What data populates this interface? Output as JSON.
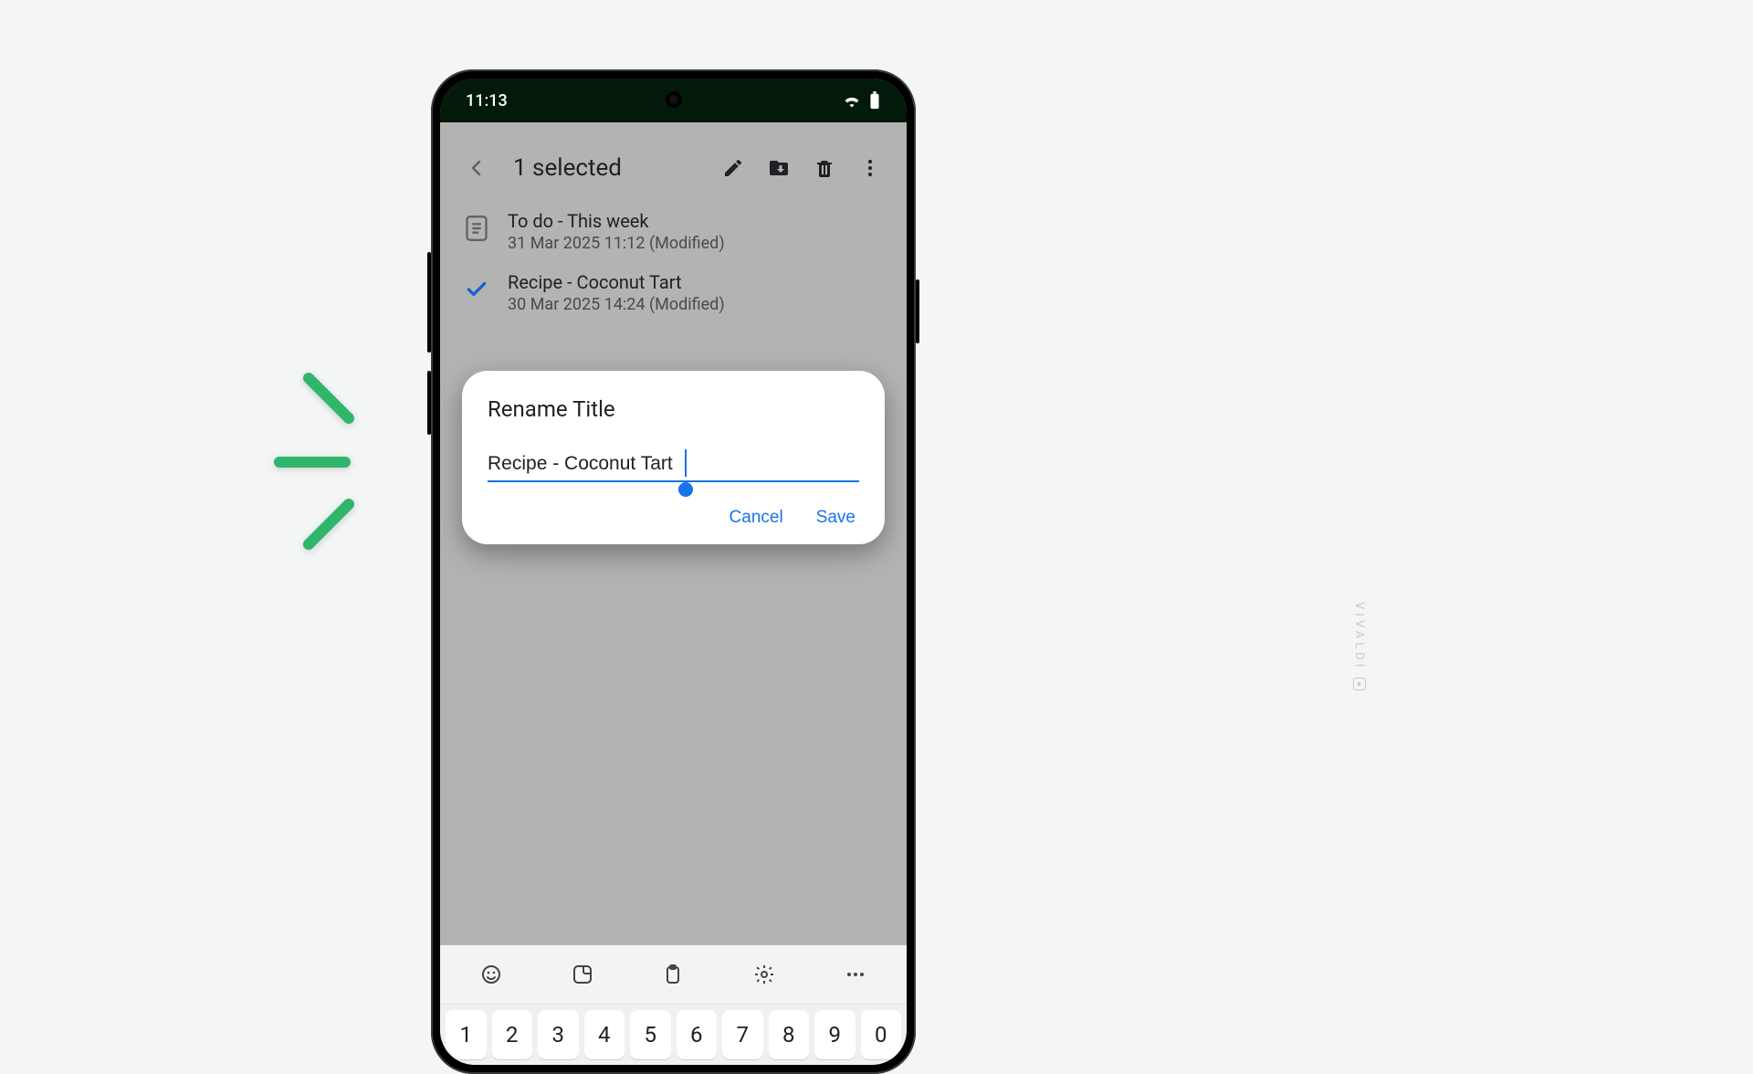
{
  "status": {
    "time": "11:13"
  },
  "topbar": {
    "title": "1 selected"
  },
  "notes": [
    {
      "title": "To do - This week",
      "meta": "31 Mar 2025 11:12 (Modified)",
      "selected": false
    },
    {
      "title": "Recipe - Coconut Tart",
      "meta": "30 Mar 2025 14:24 (Modified)",
      "selected": true
    }
  ],
  "dialog": {
    "heading": "Rename Title",
    "value": "Recipe - Coconut Tart",
    "cancel": "Cancel",
    "save": "Save"
  },
  "keyboard": {
    "digits": [
      "1",
      "2",
      "3",
      "4",
      "5",
      "6",
      "7",
      "8",
      "9",
      "0"
    ]
  },
  "watermark": "VIVALDI"
}
